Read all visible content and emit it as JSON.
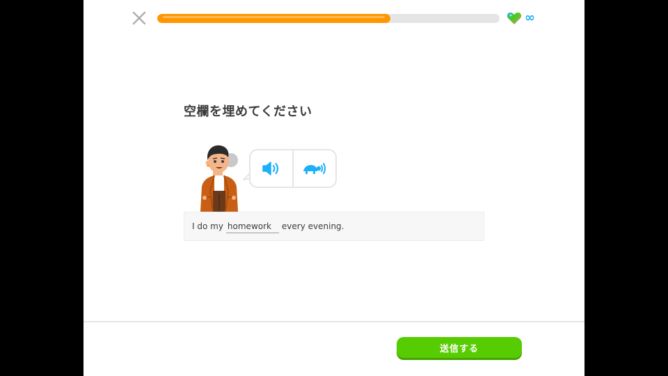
{
  "header": {
    "close_icon": "close-icon",
    "progress": 0.68,
    "progress_color": "#ff9600",
    "hearts_icon": "heart-icon",
    "hearts_count": "∞"
  },
  "challenge": {
    "prompt": "空欄を埋めてください",
    "audio_buttons": [
      {
        "icon": "speaker-icon"
      },
      {
        "icon": "turtle-slow-audio-icon"
      }
    ],
    "sentence_before": "I do my",
    "blank_value": "homework",
    "sentence_after": "every evening."
  },
  "footer": {
    "submit_label": "送信する",
    "submit_color": "#58cc02"
  }
}
